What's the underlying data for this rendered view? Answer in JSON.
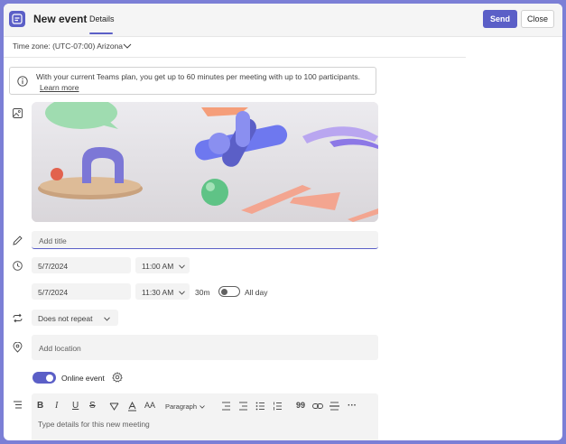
{
  "header": {
    "title": "New event",
    "tab": "Details",
    "send_label": "Send",
    "close_label": "Close",
    "accent": "#5b5fc7"
  },
  "timezone": {
    "label": "Time zone: (UTC-07:00) Arizona"
  },
  "info": {
    "text": "With your current Teams plan, you get up to 60 minutes per meeting with up to 100 participants.",
    "link": "Learn more"
  },
  "form": {
    "title_placeholder": "Add title",
    "start_date": "5/7/2024",
    "start_time": "11:00 AM",
    "end_date": "5/7/2024",
    "end_time": "11:30 AM",
    "duration": "30m",
    "all_day_label": "All day",
    "all_day": false,
    "repeat": "Does not repeat",
    "location_placeholder": "Add location",
    "online_label": "Online event",
    "online": true,
    "details_placeholder": "Type details for this new meeting"
  },
  "toolbar": {
    "bold": "B",
    "italic": "I",
    "underline": "U",
    "strike": "S",
    "font_size": "AA",
    "paragraph": "Paragraph",
    "quote": "99",
    "more": "···"
  },
  "icons": [
    "calendar-icon",
    "chevron-down-icon",
    "info-icon",
    "image-icon",
    "pencil-icon",
    "clock-icon",
    "repeat-icon",
    "location-icon",
    "settings-icon",
    "list-icon"
  ]
}
